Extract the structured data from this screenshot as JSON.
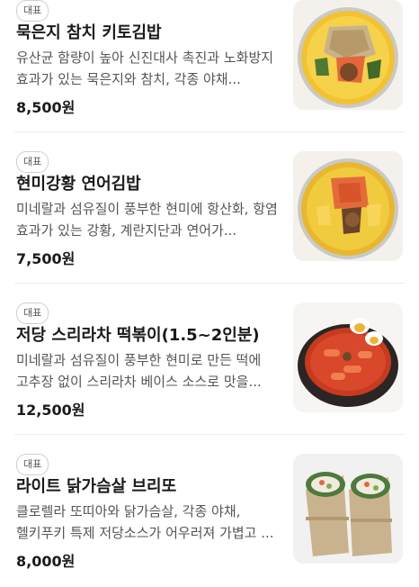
{
  "menu": {
    "items": [
      {
        "badge": "대표",
        "name": "묵은지 참치 키토김밥",
        "description": "유산균 함량이 높아 신진대사 촉진과 노화방지 효과가 있는 묵은지와 참치, 각종 야채...",
        "price": "8,500원"
      },
      {
        "badge": "대표",
        "name": "현미강황 연어김밥",
        "description": "미네랄과 섬유질이 풍부한 현미에 항산화, 항염 효과가 있는 강황, 계란지단과 연어가...",
        "price": "7,500원"
      },
      {
        "badge": "대표",
        "name": "저당 스리라차 떡볶이(1.5~2인분)",
        "description": "미네랄과 섬유질이 풍부한 현미로 만든 떡에 고추장 없이 스리라차 베이스 소스로 맛을...",
        "price": "12,500원"
      },
      {
        "badge": "대표",
        "name": "라이트 닭가슴살 브리또",
        "description": "클로렐라 또띠아와 닭가슴살, 각종 야채, 헬키푸키 특제 저당소스가 어우러져 가볍고 ...",
        "price": "8,000원"
      }
    ]
  }
}
